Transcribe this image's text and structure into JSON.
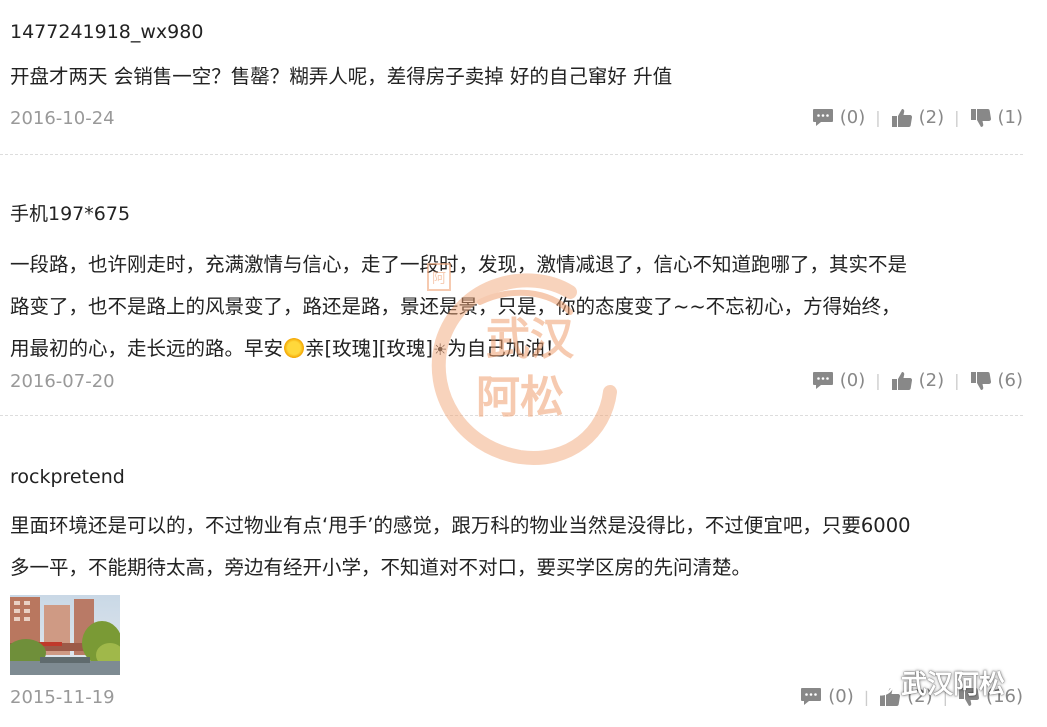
{
  "comments": [
    {
      "username": "1477241918_wx980",
      "body": "开盘才两天 会销售一空？售罄？糊弄人呢，差得房子卖掉 好的自己窜好 升值",
      "date": "2016-10-24",
      "reply_count": "(0)",
      "like_count": "(2)",
      "dislike_count": "(1)"
    },
    {
      "username": "手机197*675",
      "body_line1": "一段路，也许刚走时，充满激情与信心，走了一段时，发现，激情减退了，信心不知道跑哪了，其实不是",
      "body_line2": "路变了，也不是路上的风景变了，路还是路，景还是景，只是，你的态度变了~~不忘初心，方得始终，",
      "body_line3_a": "用最初的心，走长远的路。早安",
      "body_line3_b": "亲[玫瑰][玫瑰]",
      "body_line3_c": "为自己加油！",
      "date": "2016-07-20",
      "reply_count": "(0)",
      "like_count": "(2)",
      "dislike_count": "(6)"
    },
    {
      "username": "rockpretend",
      "body_line1": "里面环境还是可以的，不过物业有点‘甩手’的感觉，跟万科的物业当然是没得比，不过便宜吧，只要6000",
      "body_line2": "多一平，不能期待太高，旁边有经开小学，不知道对不对口，要买学区房的先问清楚。",
      "date": "2015-11-19",
      "reply_count": "(0)",
      "like_count": "(2)",
      "dislike_count": "(16)"
    }
  ],
  "watermark": {
    "line1": "武汉",
    "line2": "阿松",
    "seal": "阿",
    "color": "#f0a070"
  },
  "wechat_mark": {
    "label": "武汉阿松"
  },
  "icons": {
    "reply": "comment-bubble-icon",
    "like": "thumbs-up-icon",
    "dislike": "thumbs-down-icon",
    "sun": "sun-emoji-icon",
    "wechat": "wechat-logo-icon"
  },
  "colors": {
    "text": "#222222",
    "meta": "#999999",
    "icon": "#888888"
  }
}
